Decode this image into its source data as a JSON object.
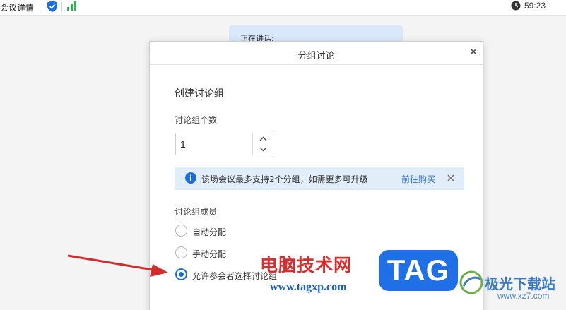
{
  "topbar": {
    "meeting_title": "会议详情",
    "timer": "59:23",
    "icons": {
      "shield": "shield-check-icon",
      "signal": "signal-bars-icon",
      "clock": "clock-icon"
    },
    "colors": {
      "shield": "#1a6fe0",
      "signal": "#2db84d"
    }
  },
  "speaking": {
    "label": "正在讲话:"
  },
  "dialog": {
    "title": "分组讨论",
    "section_title": "创建讨论组",
    "count_label": "讨论组个数",
    "count_value": "1",
    "notice": {
      "text": "该场会议最多支持2个分组，如需更多可升级",
      "link": "前往购买",
      "icon": "info-icon",
      "background": "#e2edfa",
      "link_color": "#2f6fd6"
    },
    "members_label": "讨论组成员",
    "options": [
      {
        "label": "自动分配",
        "checked": false
      },
      {
        "label": "手动分配",
        "checked": false
      },
      {
        "label": "允许参会者选择讨论组",
        "checked": true
      }
    ],
    "accent": "#1a6fe0"
  },
  "watermark": {
    "site_cn": "电脑技术网",
    "site_url": "www.tagxp.com",
    "badge": "TAG",
    "site2_cn": "极光下载站",
    "site2_url": "www.xz7.com"
  }
}
